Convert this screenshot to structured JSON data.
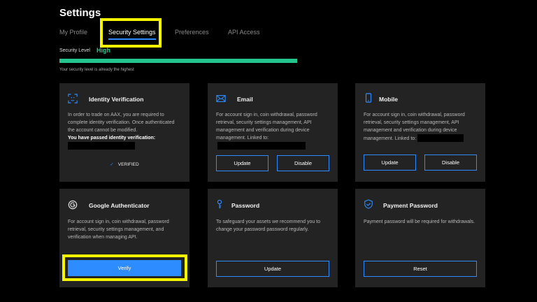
{
  "page": {
    "title": "Settings"
  },
  "tabs": [
    {
      "label": "My Profile"
    },
    {
      "label": "Security Settings"
    },
    {
      "label": "Preferences"
    },
    {
      "label": "API Access"
    }
  ],
  "security": {
    "level_label": "Security Level",
    "level_value": "High",
    "level_progress_percent": 100,
    "note": "Your security level is already the highest"
  },
  "cards": {
    "identity": {
      "title": "Identity Verification",
      "desc": "In order to trade on AAX, you are required to complete identity verification. Once authenticated the account cannot be modified.",
      "passed": "You have passed identity verification:",
      "status": "VERIFIED"
    },
    "email": {
      "title": "Email",
      "desc": "For account sign in, coin withdrawal, password retrieval, security settings management, API management and verification during device management. Linked to:",
      "update": "Update",
      "disable": "Disable"
    },
    "mobile": {
      "title": "Mobile",
      "desc": "For account sign in, coin withdrawal, password retrieval, security settings management, API management and verification during device management. Linked to:",
      "update": "Update",
      "disable": "Disable"
    },
    "google": {
      "title": "Google Authenticator",
      "desc": "For account sign in, coin withdrawal, password retrieval, security settings management, and verification when managing API.",
      "verify": "Verify"
    },
    "password": {
      "title": "Password",
      "desc": "To safeguard your assets we recommend you to change your password password regularly.",
      "update": "Update"
    },
    "payment": {
      "title": "Payment Password",
      "desc": "Payment password will be required for withdrawals.",
      "reset": "Reset"
    }
  },
  "colors": {
    "accent": "#2d8cff",
    "success": "#27c98a",
    "highlight": "#f7f400",
    "card_bg": "#232323"
  }
}
